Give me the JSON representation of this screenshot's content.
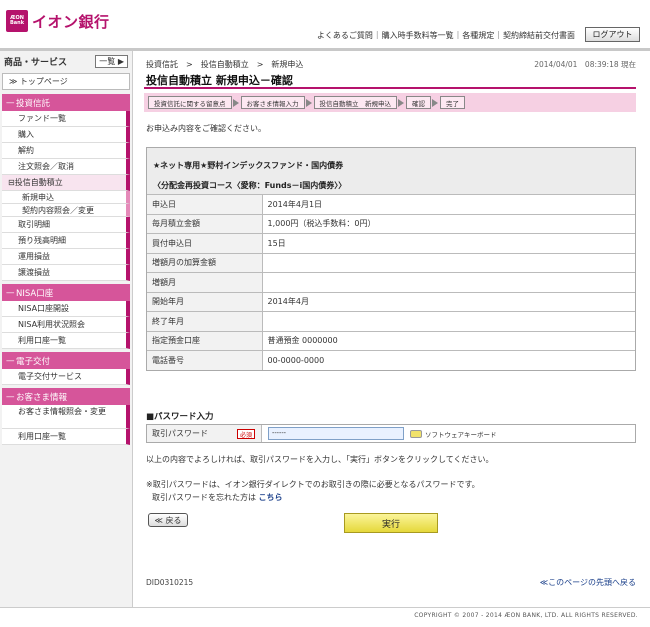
{
  "header": {
    "logo_mark_line1": "ÆON",
    "logo_mark_line2": "Bank",
    "logo_text": "イオン銀行",
    "links": [
      "よくあるご質問",
      "購入時手数料等一覧",
      "各種規定",
      "契約締結前交付書面"
    ],
    "logout_label": "ログアウト"
  },
  "sidebar": {
    "title": "商品・サービス",
    "ichiran_label": "一覧",
    "toppage": "トップページ",
    "sections": [
      {
        "title": "投資信託",
        "items": [
          "ファンド一覧",
          "購入",
          "解約",
          "注文照会／取消"
        ],
        "group": "投信自動積立",
        "subitems": [
          "新規申込",
          "契約内容照会／変更"
        ],
        "items_after": [
          "取引明細",
          "預り残高明細",
          "運用損益",
          "譲渡損益"
        ]
      },
      {
        "title": "NISA口座",
        "items": [
          "NISA口座開設",
          "NISA利用状況照会",
          "利用口座一覧"
        ]
      },
      {
        "title": "電子交付",
        "items": [
          "電子交付サービス"
        ]
      },
      {
        "title": "お客さま情報",
        "items": [
          "お客さま情報照会・変更",
          "利用口座一覧"
        ]
      }
    ]
  },
  "main": {
    "breadcrumb": "投資信託　>　投信自動積立　>　新規申込",
    "datetime": "2014/04/01　08:39:18 現在",
    "title": "投信自動積立 新規申込－確認",
    "steps": [
      "投資信託に関する留意点",
      "お客さま情報入力",
      "投信自動積立　新規申込",
      "確認",
      "完了"
    ],
    "confirm_message": "お申込み内容をご確認ください。",
    "fund_name": "★ネット専用★野村インデックスファンド・国内債券",
    "fund_sub": "〈分配金再投資コース〈愛称：Funds－i国内債券〉〉",
    "details": [
      {
        "label": "申込日",
        "value": "2014年4月1日"
      },
      {
        "label": "毎月積立金額",
        "value": "1,000円（税込手数料：0円）"
      },
      {
        "label": "買付申込日",
        "value": "15日"
      },
      {
        "label": "増額月の加算金額",
        "value": ""
      },
      {
        "label": "増額月",
        "value": ""
      },
      {
        "label": "開始年月",
        "value": "2014年4月"
      },
      {
        "label": "終了年月",
        "value": ""
      },
      {
        "label": "指定預金口座",
        "value": "普通預金 0000000"
      },
      {
        "label": "電話番号",
        "value": "00-0000-0000"
      }
    ],
    "password_heading": "■パスワード入力",
    "password_label": "取引パスワード",
    "required_badge": "必須",
    "password_value": "------",
    "keyboard_label": "ソフトウェアキーボード",
    "instruction": "以上の内容でよろしければ、取引パスワードを入力し、「実行」ボタンをクリックしてください。",
    "note_1": "※取引パスワードは、イオン銀行ダイレクトでのお取引きの際に必要となるパスワードです。",
    "note_2_prefix": "取引パスワードを忘れた方は",
    "note_2_link": "こちら",
    "back_label": "≪ 戻る",
    "execute_label": "実行",
    "page_id": "DID0310215",
    "to_top": "≪このページの先頭へ戻る"
  },
  "footer": {
    "copyright": "COPYRIGHT © 2007 - 2014 ÆON BANK, LTD. ALL RIGHTS RESERVED."
  },
  "colors": {
    "brand": "#b5126c",
    "section": "#d6559a",
    "steps_bg": "#f6d0e3",
    "execute": "#e5d83b"
  }
}
